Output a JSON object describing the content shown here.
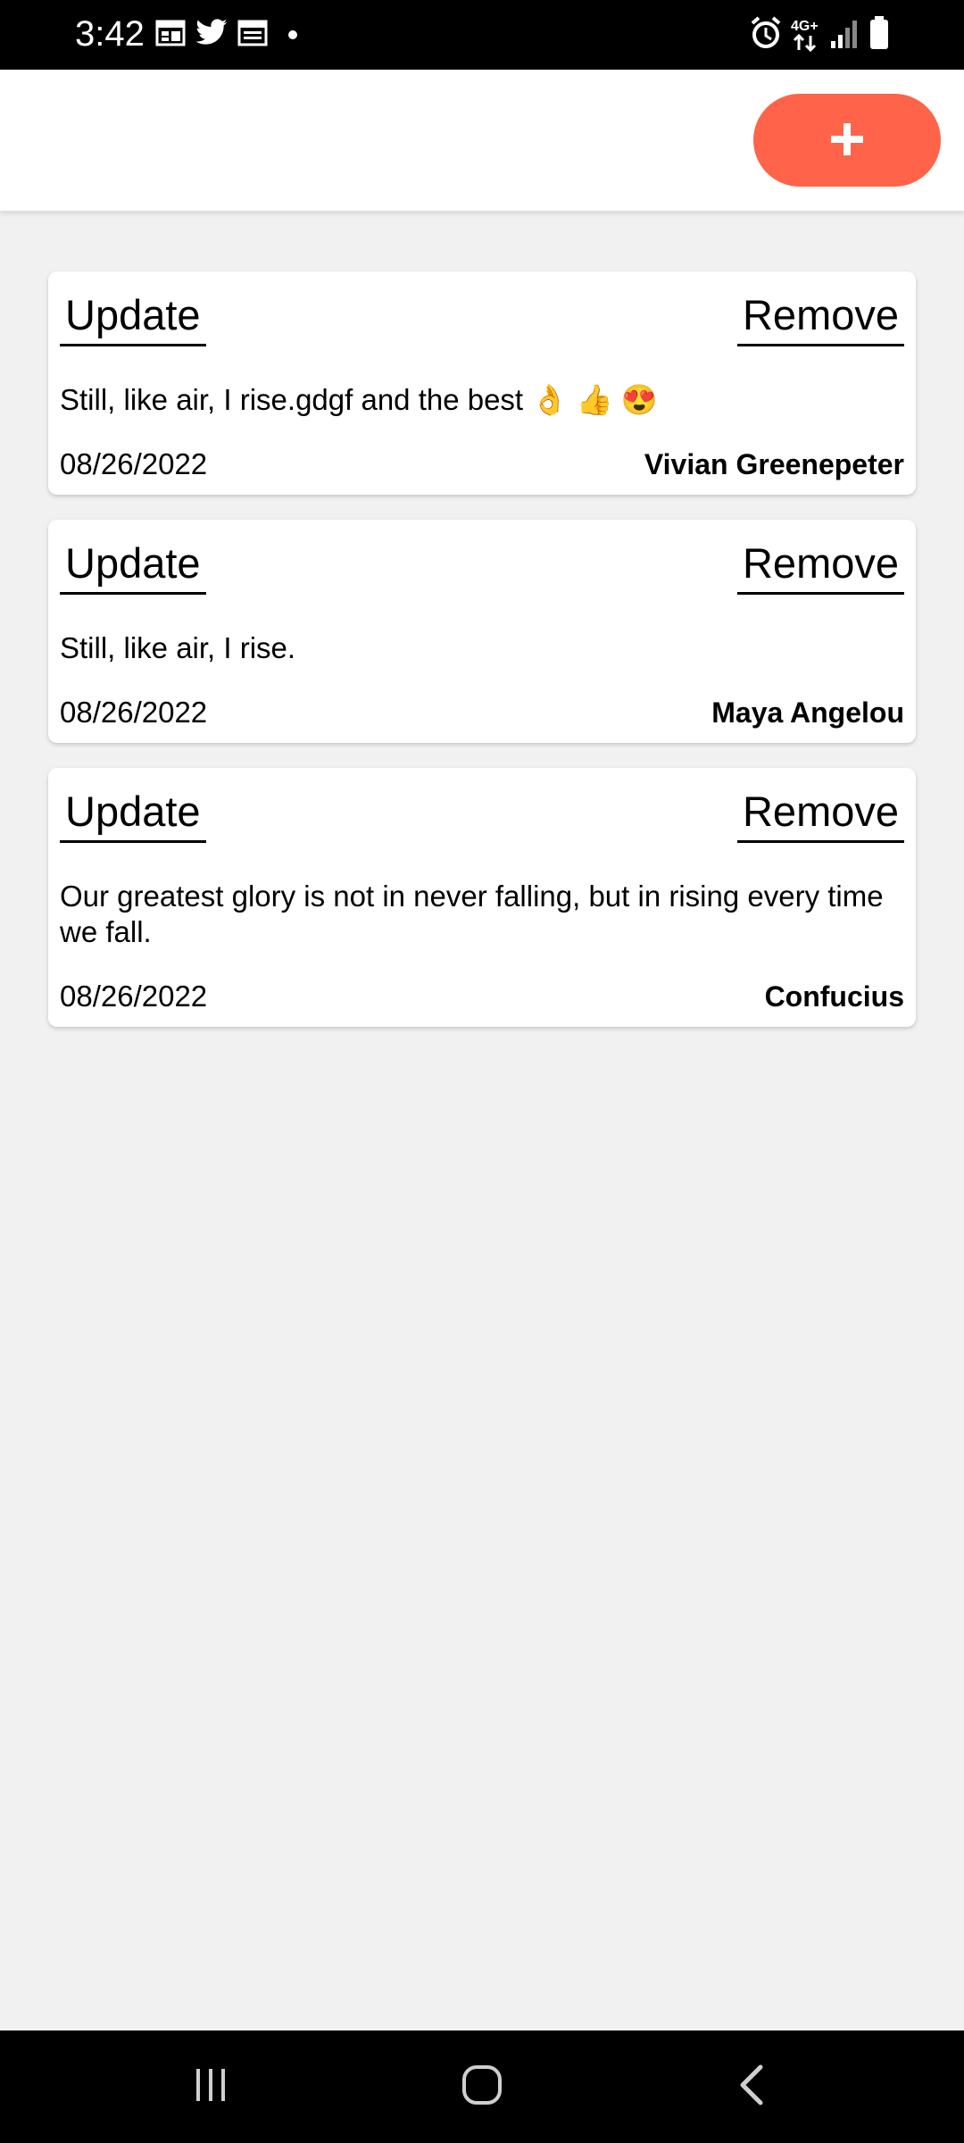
{
  "status_bar": {
    "time": "3:42",
    "left_icons": [
      "calendar-icon",
      "twitter-icon",
      "calendar-icon",
      "dot-icon"
    ],
    "right_icons": [
      "alarm-icon",
      "4g-data-icon",
      "signal-icon",
      "battery-icon"
    ],
    "network_label": "4G+"
  },
  "app_bar": {
    "add_button_icon": "plus-icon",
    "accent_color": "#ff6349"
  },
  "quotes": [
    {
      "update_label": "Update",
      "remove_label": "Remove",
      "text": "Still, like air, I rise.gdgf and the best 👌 👍 😍",
      "date": "08/26/2022",
      "author": "Vivian Greenepeter"
    },
    {
      "update_label": "Update",
      "remove_label": "Remove",
      "text": "Still, like air, I rise.",
      "date": "08/26/2022",
      "author": "Maya Angelou"
    },
    {
      "update_label": "Update",
      "remove_label": "Remove",
      "text": "Our greatest glory is not in never falling, but in rising every time we fall.",
      "date": "08/26/2022",
      "author": "Confucius"
    }
  ],
  "nav_bar": {
    "icons": [
      "recent-apps-icon",
      "home-icon",
      "back-icon"
    ]
  }
}
